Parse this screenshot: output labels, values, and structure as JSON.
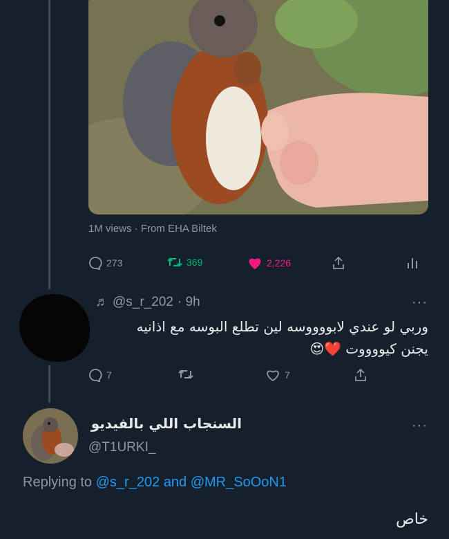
{
  "media": {
    "views_text": "1M views · From EHA Biltek",
    "image_desc": "squirrel-photo"
  },
  "tweet_actions": {
    "replies": "273",
    "retweets": "369",
    "likes": "2,226"
  },
  "reply1": {
    "handle": "@s_r_202",
    "time": "· 9h",
    "text_line1": "وربي لو عندي لابووووسه لين تطلع البوسه مع اذانيه",
    "text_line2": "يجنن كيووووت",
    "emoji": "❤️😍",
    "replies": "7",
    "likes": "7"
  },
  "reply2": {
    "display_name": "السنجاب اللي بالفيديو",
    "handle": "@T1URKI_",
    "replying_prefix": "Replying to",
    "replying_user1": "@s_r_202",
    "replying_and": "and",
    "replying_user2": "@MR_SoOoN1",
    "text": "خاص"
  },
  "colors": {
    "background": "#16202c",
    "like": "#f91880",
    "retweet": "#00ba7c",
    "link": "#1d9bf0",
    "muted": "#8b98a5"
  }
}
